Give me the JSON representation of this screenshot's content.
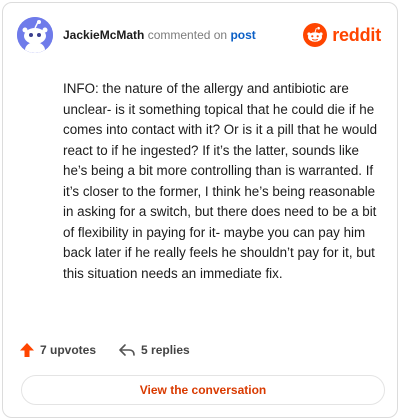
{
  "header": {
    "username": "JackieMcMath",
    "verb": "commented on",
    "post_link": "post",
    "brand": "reddit"
  },
  "comment": {
    "text": "INFO: the nature of the allergy and antibiotic are unclear- is it something topical that he could die if he comes into contact with it? Or is it a pill that he would react to if he ingested? If it’s the latter, sounds like he’s being a bit more controlling than is warranted. If it’s closer to the former, I think he’s being reasonable in asking for a switch, but there does need to be a bit of flexibility in paying for it- maybe you can pay him back later if he really feels he shouldn’t pay for it, but this situation needs an immediate fix."
  },
  "actions": {
    "upvotes": "7 upvotes",
    "replies": "5 replies"
  },
  "footer": {
    "view_button": "View the conversation"
  },
  "icons": {
    "avatar": "snoo-avatar-icon",
    "brand": "reddit-logo-icon",
    "upvote": "upvote-arrow-icon",
    "reply": "reply-arrow-icon"
  },
  "colors": {
    "brand": "#ff4500",
    "link": "#0b5fc6",
    "button_text": "#d93a00",
    "avatar_bg": "#6f7bea"
  }
}
